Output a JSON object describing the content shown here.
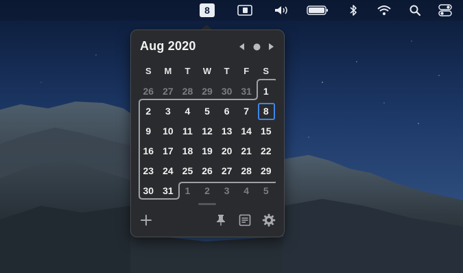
{
  "menubar": {
    "date_badge": "8",
    "icons": [
      "screen-mirror-icon",
      "volume-icon",
      "battery-icon",
      "bluetooth-icon",
      "wifi-icon",
      "search-icon",
      "control-center-icon"
    ]
  },
  "calendar": {
    "title": "Aug 2020",
    "weekdays": [
      "S",
      "M",
      "T",
      "W",
      "T",
      "F",
      "S"
    ],
    "weeks": [
      [
        "26",
        "27",
        "28",
        "29",
        "30",
        "31",
        "1"
      ],
      [
        "2",
        "3",
        "4",
        "5",
        "6",
        "7",
        "8"
      ],
      [
        "9",
        "10",
        "11",
        "12",
        "13",
        "14",
        "15"
      ],
      [
        "16",
        "17",
        "18",
        "19",
        "20",
        "21",
        "22"
      ],
      [
        "23",
        "24",
        "25",
        "26",
        "27",
        "28",
        "29"
      ],
      [
        "30",
        "31",
        "1",
        "2",
        "3",
        "4",
        "5"
      ]
    ],
    "today": "8",
    "accent_color": "#3f86ea"
  },
  "footer": {
    "icons": [
      "add-icon",
      "pin-icon",
      "notes-icon",
      "settings-gear-icon"
    ]
  }
}
